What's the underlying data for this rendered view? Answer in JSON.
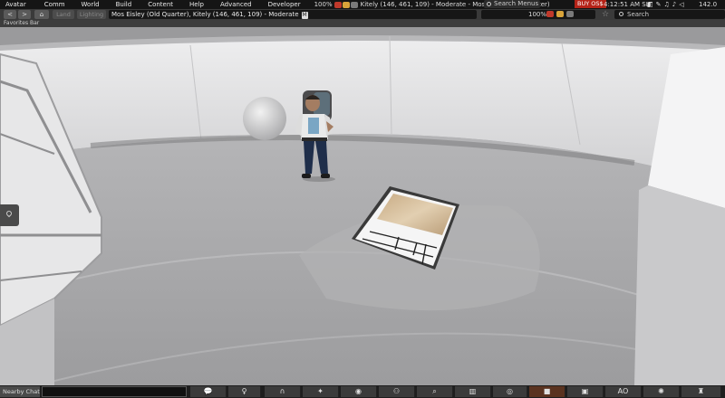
{
  "menu": {
    "items": [
      "Avatar",
      "Comm",
      "World",
      "Build",
      "Content",
      "Help",
      "Advanced",
      "Developer"
    ],
    "zoom": "100%",
    "region": "Kitely (146, 461, 109) - Moderate - Mos Eisley (Old Quarter)",
    "search_placeholder": "Search Menus",
    "buy_label": "BUY OS$",
    "clock": "4:12:51 AM SLT",
    "fps": "142.0"
  },
  "nav": {
    "back_glyph": "<",
    "forward_glyph": ">",
    "home_glyph": "⌂",
    "land_label": "Land",
    "lighting_label": "Lighting",
    "location": "Mos Eisley (Old Quarter), Kitely (146, 461, 109) - Moderate",
    "maturity_badge": "M",
    "zoom": "100%",
    "search_placeholder": "Search"
  },
  "favorites": {
    "label": "Favorites Bar"
  },
  "bottom": {
    "chat_label": "Nearby Chat",
    "ao_label": "AO"
  },
  "colors": {
    "menubar": "#151515",
    "buy_button": "#b52318",
    "floor": "#a9a9ab",
    "wall": "#d9d9d9"
  }
}
